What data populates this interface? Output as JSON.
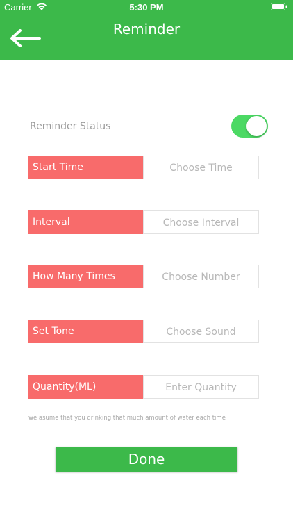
{
  "status_bar": {
    "carrier": "Carrier",
    "time": "5:30 PM"
  },
  "header": {
    "title": "Reminder",
    "back_icon": "arrow-left-icon",
    "color": "#3cb94a"
  },
  "reminder_status": {
    "label": "Reminder Status",
    "enabled": true,
    "toggle_color": "#4cd964"
  },
  "fields": [
    {
      "label": "Start Time",
      "placeholder": "Choose Time"
    },
    {
      "label": "Interval",
      "placeholder": "Choose Interval"
    },
    {
      "label": "How Many Times",
      "placeholder": "Choose Number"
    },
    {
      "label": "Set Tone",
      "placeholder": "Choose Sound"
    },
    {
      "label": "Quantity(ML)",
      "placeholder": "Enter Quantity"
    }
  ],
  "note": "we asume that you drinking that much amount of water each time",
  "done_label": "Done",
  "colors": {
    "label_bg": "#f86b6b",
    "button_bg": "#3cb94a"
  }
}
